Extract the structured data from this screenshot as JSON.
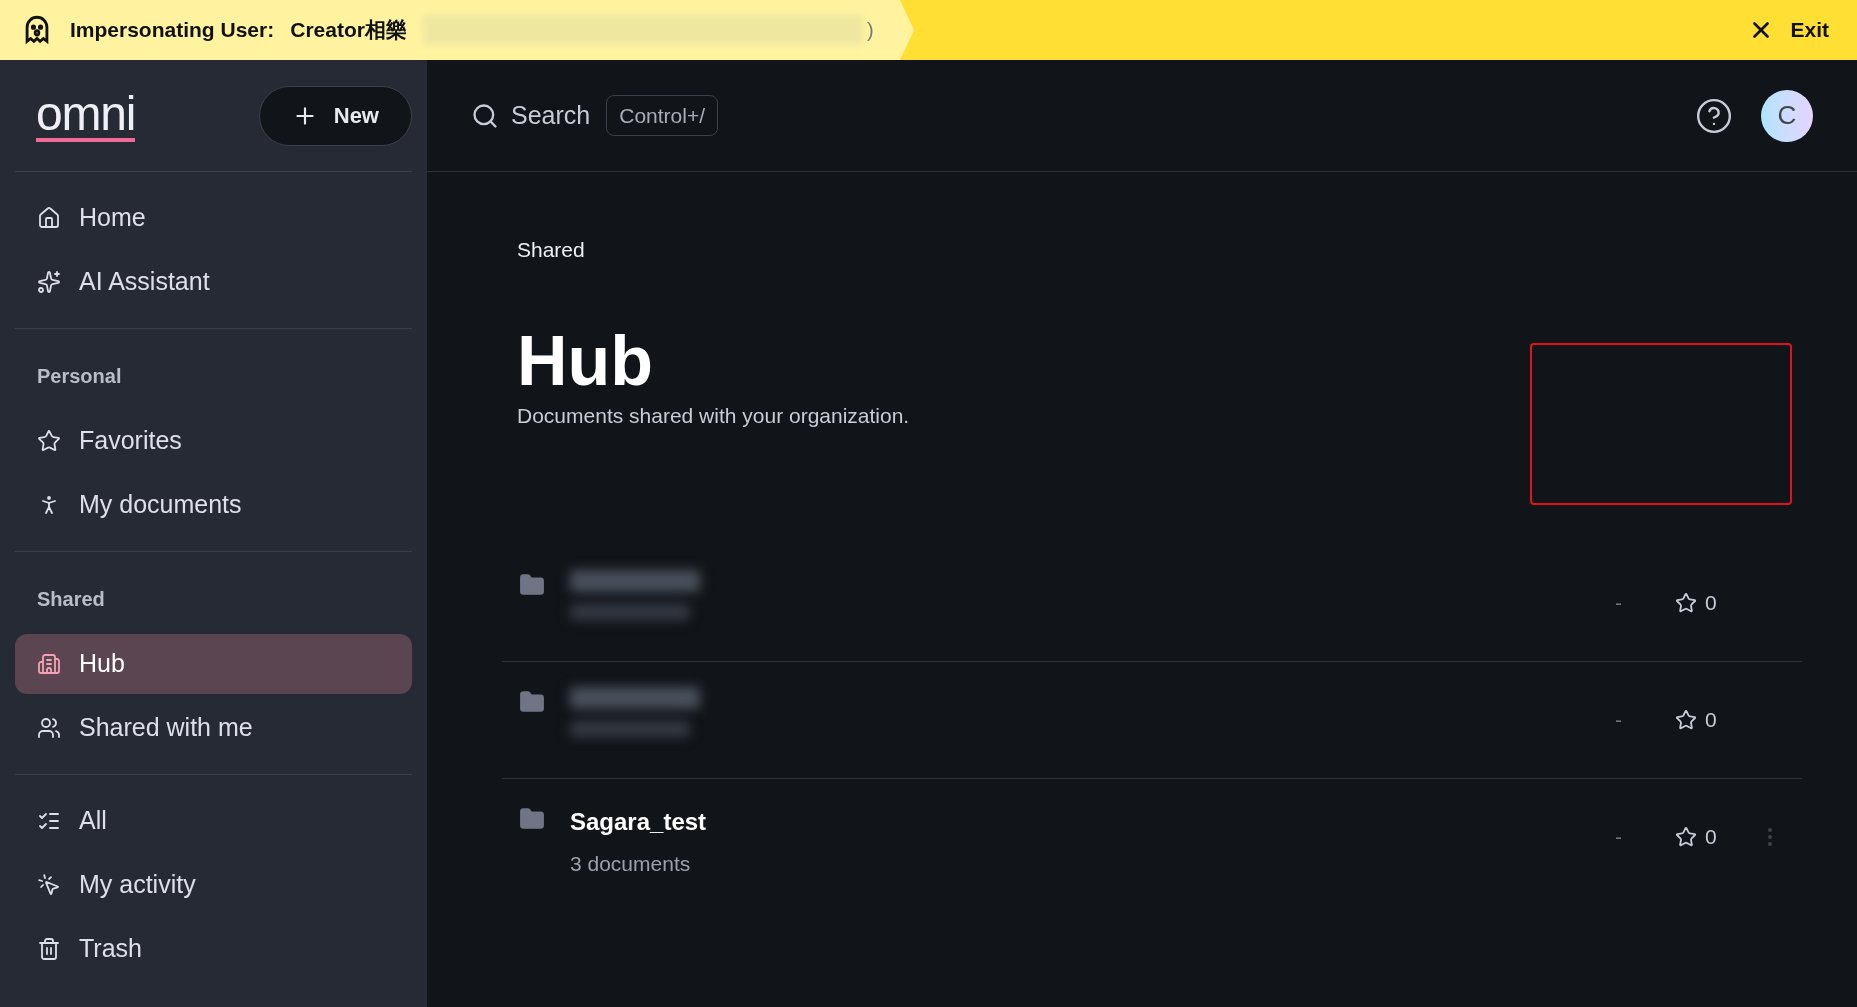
{
  "banner": {
    "label": "Impersonating User:",
    "user": "Creator相樂",
    "user_suffix": ")",
    "exit": "Exit"
  },
  "sidebar": {
    "logo": "omni",
    "new_button": "New",
    "groups": [
      {
        "items": [
          {
            "label": "Home",
            "selected": false
          },
          {
            "label": "AI Assistant",
            "selected": false
          }
        ]
      },
      {
        "title": "Personal",
        "items": [
          {
            "label": "Favorites",
            "selected": false
          },
          {
            "label": "My documents",
            "selected": false
          }
        ]
      },
      {
        "title": "Shared",
        "items": [
          {
            "label": "Hub",
            "selected": true
          },
          {
            "label": "Shared with me",
            "selected": false
          }
        ]
      },
      {
        "items": [
          {
            "label": "All",
            "selected": false
          },
          {
            "label": "My activity",
            "selected": false
          },
          {
            "label": "Trash",
            "selected": false
          }
        ]
      }
    ]
  },
  "header": {
    "search": "Search",
    "shortcut": "Control+/",
    "avatar": "C"
  },
  "page": {
    "breadcrumb": "Shared",
    "title": "Hub",
    "subtitle": "Documents shared with your organization.",
    "rows": [
      {
        "kind": "redacted",
        "updated": "-",
        "stars": "0",
        "menu": false
      },
      {
        "kind": "redacted",
        "updated": "-",
        "stars": "0",
        "menu": false
      },
      {
        "kind": "folder",
        "name": "Sagara_test",
        "count": "3 documents",
        "updated": "-",
        "stars": "0",
        "menu": true
      }
    ]
  }
}
